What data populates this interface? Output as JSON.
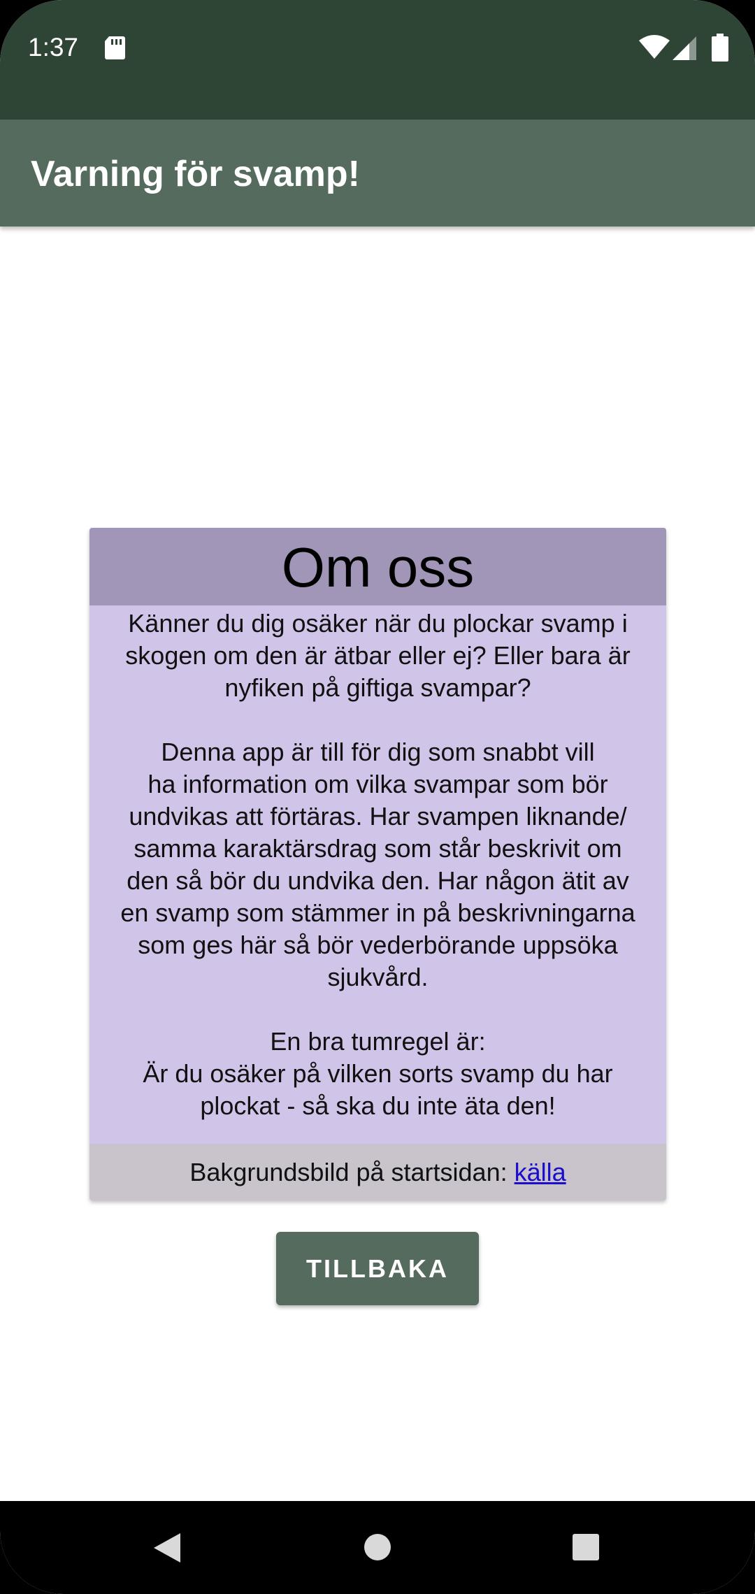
{
  "status_bar": {
    "time": "1:37",
    "icons": [
      "sd-card-icon",
      "wifi-icon",
      "signal-icon",
      "battery-icon"
    ]
  },
  "app_bar": {
    "title": "Varning för svamp!"
  },
  "about_card": {
    "title": "Om oss",
    "paragraphs": [
      "Känner du dig osäker när du plockar svamp i\nskogen om den är ätbar eller ej? Eller bara är\nnyfiken på giftiga svampar?",
      " Denna app är till för dig som snabbt vill\nha information om vilka svampar som bör\nundvikas att förtäras. Har svampen liknande/\nsamma karaktärsdrag som står beskrivit om\nden så bör du undvika den. Har någon ätit av\nen svamp som stämmer in på beskrivningarna\nsom ges här så bör vederbörande uppsöka\nsjukvård.",
      "En bra tumregel är:\nÄr du osäker på vilken sorts svamp du har\nplockat - så ska du inte äta den!"
    ],
    "footer_text": "Bakgrundsbild på startsidan: ",
    "footer_link": "källa"
  },
  "back_button": {
    "label": "TILLBAKA"
  },
  "nav_bar": {
    "icons": [
      "back-icon",
      "home-icon",
      "recents-icon"
    ]
  },
  "colors": {
    "status_bar": "#2e4435",
    "app_bar": "#556b5d",
    "card_header": "#a196b7",
    "card_body": "#d1c4e9",
    "card_footer": "#c9c3cb",
    "link": "#1a0dcc",
    "button": "#556b5d"
  }
}
